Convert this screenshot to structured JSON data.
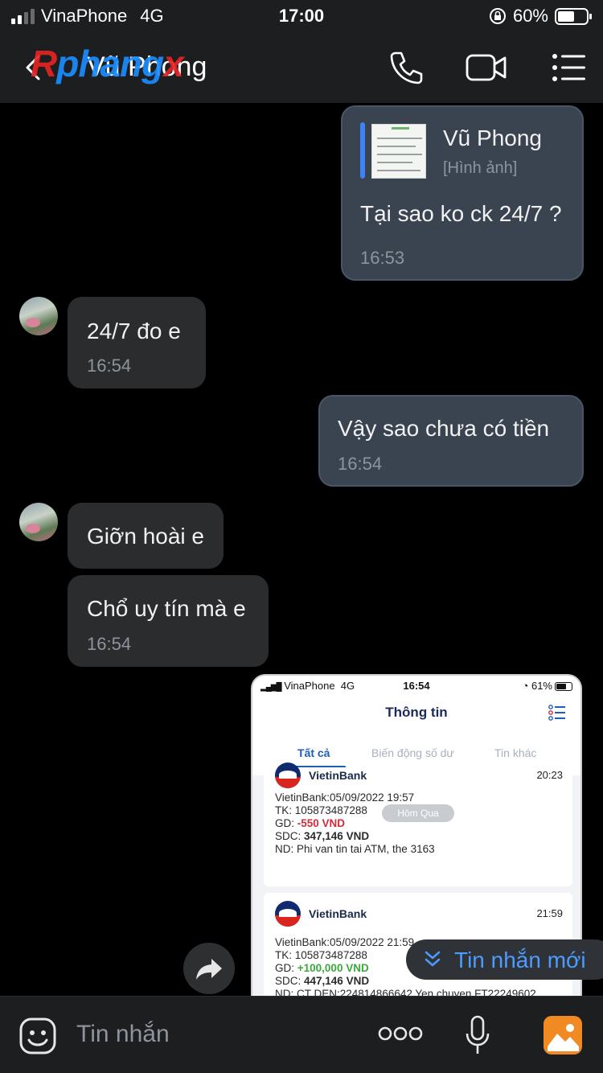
{
  "status": {
    "carrier": "VinaPhone",
    "network": "4G",
    "time": "17:00",
    "battery": "60%"
  },
  "header": {
    "contact_name": "Vũ Phong",
    "watermark": "Rphangx"
  },
  "messages": {
    "m1": {
      "reply_name": "Vũ Phong",
      "reply_sub": "[Hình ảnh]",
      "text": "Tại sao ko ck 24/7 ?",
      "time": "16:53"
    },
    "m2": {
      "text": "24/7 đo e",
      "time": "16:54"
    },
    "m3": {
      "text": "Vậy sao chưa có tiền",
      "time": "16:54"
    },
    "m4": {
      "text": "Giỡn hoài e"
    },
    "m5": {
      "text": "Chổ uy tín mà e",
      "time": "16:54"
    }
  },
  "screenshot": {
    "carrier": "VinaPhone",
    "network": "4G",
    "time": "16:54",
    "battery": "61%",
    "title": "Thông tin",
    "tabs": [
      "Tất cả",
      "Biến động số dư",
      "Tin khác"
    ],
    "pill": "Hôm Qua",
    "card1": {
      "bank": "VietinBank",
      "time": "20:23",
      "line1": "VietinBank:05/09/2022 19:57",
      "line2": "TK: 105873487288",
      "gd_label": "GD: ",
      "gd_value": "-550 VND",
      "sdc_label": "SDC: ",
      "sdc_value": "347,146 VND",
      "line5": "ND: Phi van tin tai ATM, the 3163"
    },
    "card2": {
      "bank": "VietinBank",
      "time": "21:59",
      "line1": "VietinBank:05/09/2022 21:59",
      "line2": "TK: 105873487288",
      "gd_label": "GD: ",
      "gd_value": "+100,000 VND",
      "sdc_label": "SDC: ",
      "sdc_value": "447,146 VND",
      "line5": "ND: CT DEN:224814866642 Yen chuyen FT22249602"
    }
  },
  "new_message_label": "Tin nhắn mới",
  "composer": {
    "placeholder": "Tin nhắn"
  }
}
